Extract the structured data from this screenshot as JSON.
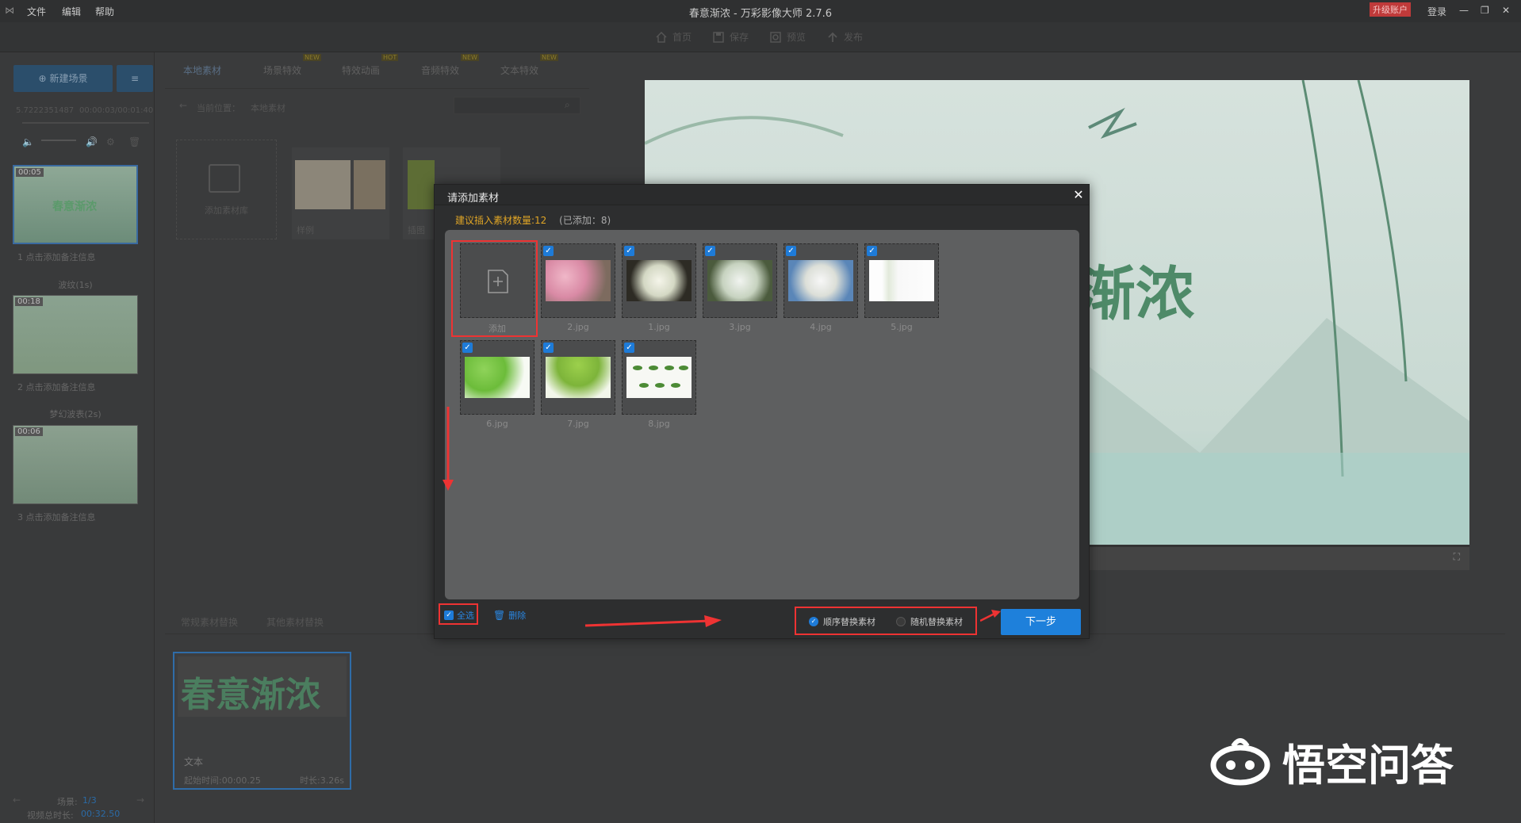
{
  "window": {
    "title": "春意渐浓 - 万彩影像大师 2.7.6",
    "menu": [
      "文件",
      "编辑",
      "帮助"
    ],
    "upgrade_label": "升级账户",
    "login_label": "登录"
  },
  "toolbar": {
    "home": "首页",
    "save": "保存",
    "preview": "预览",
    "publish": "发布"
  },
  "left": {
    "new_scene": "新建场景",
    "time_left": "5.7222351487",
    "time_right": "00:00:03/00:01:40",
    "scenes": [
      {
        "time": "00:05",
        "title": "春意渐浓",
        "caption": "1  点击添加备注信息"
      },
      {
        "time": "00:18",
        "caption": "2  点击添加备注信息"
      },
      {
        "time": "00:06",
        "caption": "3  点击添加备注信息"
      }
    ],
    "transitions": [
      "波纹(1s)",
      "梦幻波表(2s)"
    ],
    "scene_counter_label": "场景:",
    "scene_counter_value": "1/3",
    "total_label": "视频总时长:",
    "total_value": "00:32.50"
  },
  "material": {
    "tabs": [
      {
        "label": "本地素材",
        "badge": ""
      },
      {
        "label": "场景特效",
        "badge": "NEW"
      },
      {
        "label": "特效动画",
        "badge": "HOT"
      },
      {
        "label": "音频特效",
        "badge": "NEW"
      },
      {
        "label": "文本特效",
        "badge": "NEW"
      }
    ],
    "location_label": "当前位置：",
    "location_value": "本地素材",
    "add_library": "添加素材库",
    "sample": "样例",
    "sample2": "插图"
  },
  "bottom": {
    "tabs": [
      "常规素材替换",
      "其他素材替换"
    ],
    "card_title": "春意渐浓",
    "card_type": "文本",
    "card_start": "起始时间:00:00.25",
    "card_duration": "时长:3.26s"
  },
  "dialog": {
    "title": "请添加素材",
    "hint_prefix": "建议插入素材数量:12",
    "hint_added": "(已添加：8)",
    "add_label": "添加",
    "files": [
      "2.jpg",
      "1.jpg",
      "3.jpg",
      "4.jpg",
      "5.jpg",
      "6.jpg",
      "7.jpg",
      "8.jpg"
    ],
    "select_all": "全选",
    "delete": "删除",
    "radio_sequential": "顺序替换素材",
    "radio_random": "随机替换素材",
    "next": "下一步"
  },
  "preview": {
    "title_partial": "渐浓"
  },
  "watermark": {
    "text": "悟空问答"
  }
}
